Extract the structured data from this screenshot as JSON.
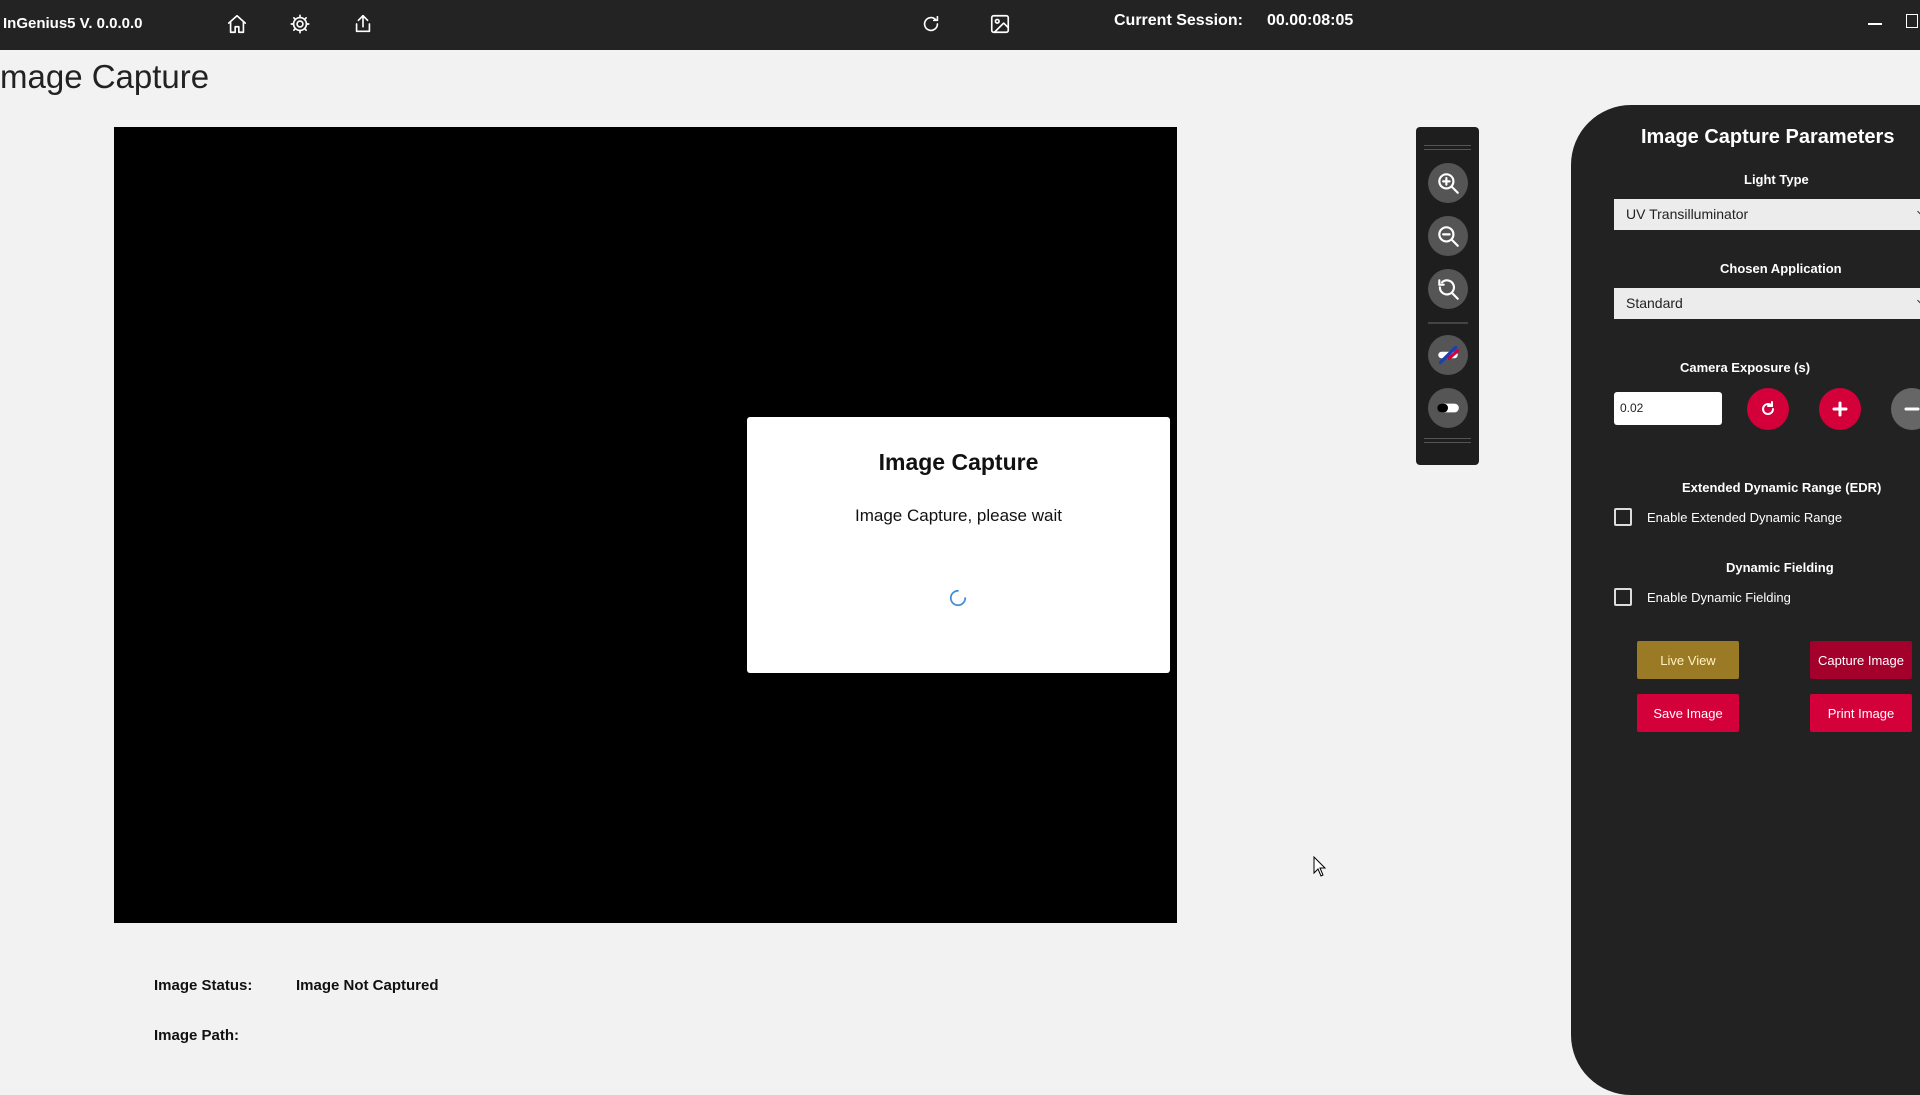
{
  "app": {
    "title": "InGenius5 V. 0.0.0.0",
    "session_label": "Current Session:",
    "session_value": "00.00:08:05",
    "icons": [
      "home-icon",
      "gear-icon",
      "share-icon",
      "refresh-icon",
      "image-icon"
    ]
  },
  "page": {
    "title": "mage Capture"
  },
  "modal": {
    "title": "Image Capture",
    "message": "Image Capture, please wait"
  },
  "status": {
    "image_status_label": "Image Status:",
    "image_status_value": "Image Not Captured",
    "image_path_label": "Image Path:",
    "image_path_value": ""
  },
  "toolstrip": {
    "tools": [
      "zoom-in-icon",
      "zoom-out-icon",
      "zoom-reset-icon",
      "contrast-adjust-icon",
      "invert-icon"
    ]
  },
  "panel": {
    "title": "Image Capture Parameters",
    "light_type_label": "Light Type",
    "light_type_value": "UV Transilluminator",
    "application_label": "Chosen Application",
    "application_value": "Standard",
    "exposure_label": "Camera Exposure (s)",
    "exposure_value": "0.02",
    "edr_label": "Extended Dynamic Range (EDR)",
    "edr_checkbox_label": "Enable Extended Dynamic Range",
    "edr_checked": false,
    "df_label": "Dynamic Fielding",
    "df_checkbox_label": "Enable Dynamic Fielding",
    "df_checked": false,
    "buttons": {
      "live_view": "Live View",
      "capture_image": "Capture Image",
      "save_image": "Save Image",
      "print_image": "Print Image"
    }
  },
  "colors": {
    "accent_red": "#d4003a",
    "accent_maroon": "#a4002c",
    "accent_gold": "#9b7a26",
    "titlebar": "#232323",
    "panel": "#222222"
  }
}
